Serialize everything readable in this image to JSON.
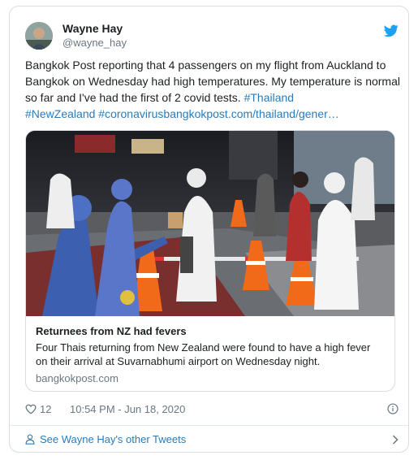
{
  "tweet": {
    "author_name": "Wayne Hay",
    "author_handle": "@wayne_hay",
    "text_plain": "Bangkok Post reporting that 4 passengers on my flight from Auckland to Bangkok on Wednesday had high temperatures. My temperature is normal so far and I've had the first of 2 covid tests. ",
    "hashtag_1": "#Thailand",
    "hashtag_2": "#NewZealand",
    "link_text": "#coronavirusbangkokpost.com/thailand/gener…",
    "like_count": "12",
    "timestamp": "10:54 PM - Jun 18, 2020"
  },
  "link_card": {
    "title": "Returnees from NZ had fevers",
    "description": "Four Thais returning from New Zealand were found to have a high fever on their arrival at Suvarnabhumi airport on Wednesday night.",
    "domain": "bangkokpost.com"
  },
  "footer": {
    "label": "See Wayne Hay's other Tweets"
  },
  "colors": {
    "link": "#2b7bb9",
    "muted": "#697882",
    "twitter_blue": "#1da1f2"
  },
  "icons": [
    "twitter-bird-icon",
    "heart-icon",
    "info-icon",
    "person-icon",
    "chevron-right-icon"
  ]
}
